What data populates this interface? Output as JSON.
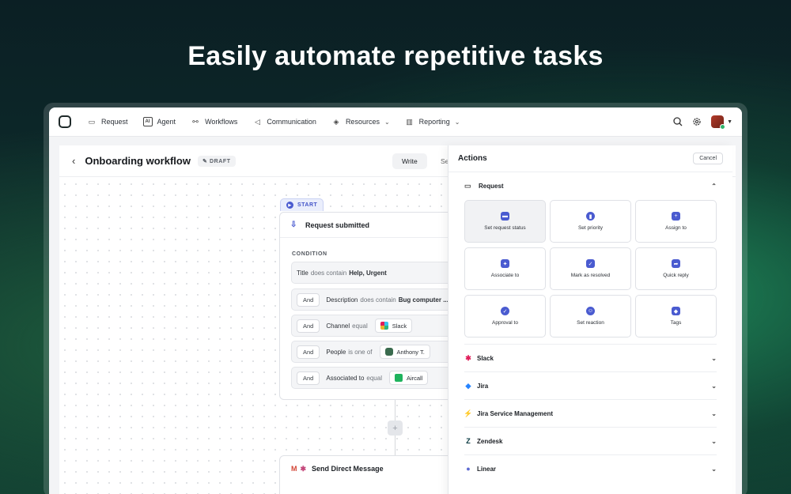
{
  "headline": "Easily automate repetitive tasks",
  "nav": {
    "items": [
      {
        "label": "Request",
        "icon": "inbox-icon"
      },
      {
        "label": "Agent",
        "icon": "ai-icon"
      },
      {
        "label": "Workflows",
        "icon": "workflow-icon"
      },
      {
        "label": "Communication",
        "icon": "megaphone-icon"
      },
      {
        "label": "Resources",
        "icon": "layers-icon"
      },
      {
        "label": "Reporting",
        "icon": "chart-icon"
      }
    ]
  },
  "workflow": {
    "title": "Onboarding workflow",
    "status": "DRAFT",
    "tab_write": "Write",
    "tab_partial": "Se"
  },
  "trigger": {
    "badge": "START",
    "title": "Request submitted",
    "condition_label": "CONDITION",
    "first": {
      "field": "Title",
      "op": "does contain",
      "value": "Help, Urgent"
    },
    "rows": [
      {
        "and": "And",
        "field": "Description",
        "op": "does contain",
        "value": "Bug computer ..."
      },
      {
        "and": "And",
        "field": "Channel",
        "op": "equal",
        "chip": "Slack"
      },
      {
        "and": "And",
        "field": "People",
        "op": "is one of",
        "chip": "Anthony T."
      },
      {
        "and": "And",
        "field": "Associated to",
        "op": "equal",
        "chip": "Aircall"
      }
    ]
  },
  "step2": {
    "title": "Send Direct Message"
  },
  "panel": {
    "title": "Actions",
    "cancel": "Cancel",
    "request_section": "Request",
    "tiles": [
      {
        "label": "Set request status",
        "icon": "ticket-icon"
      },
      {
        "label": "Set priority",
        "icon": "priority-icon"
      },
      {
        "label": "Assign to",
        "icon": "assign-user-icon"
      },
      {
        "label": "Associate to",
        "icon": "pin-icon"
      },
      {
        "label": "Mark as resolved",
        "icon": "check-square-icon"
      },
      {
        "label": "Quick reply",
        "icon": "reply-arrow-icon"
      },
      {
        "label": "Approval to",
        "icon": "check-circle-icon"
      },
      {
        "label": "Set reaction",
        "icon": "smiley-icon"
      },
      {
        "label": "Tags",
        "icon": "tag-icon"
      }
    ],
    "integrations": [
      {
        "label": "Slack",
        "icon": "slack-icon"
      },
      {
        "label": "Jira",
        "icon": "jira-icon"
      },
      {
        "label": "Jira Service Management",
        "icon": "jira-service-management-icon"
      },
      {
        "label": "Zendesk",
        "icon": "zendesk-icon"
      },
      {
        "label": "Linear",
        "icon": "linear-icon"
      }
    ]
  },
  "colors": {
    "accent": "#4a5bd0",
    "start_badge": "#4354c8"
  }
}
